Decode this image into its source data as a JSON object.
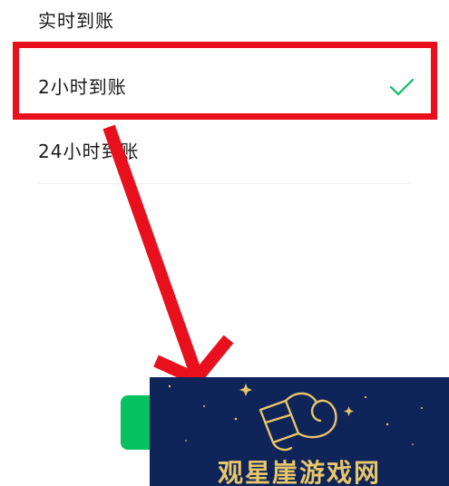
{
  "options": [
    {
      "label": "实时到账",
      "selected": false
    },
    {
      "label": "2小时到账",
      "selected": true
    },
    {
      "label": "24小时到账",
      "selected": false
    }
  ],
  "colors": {
    "annotation_red": "#e8101c",
    "check_green": "#07c160",
    "button_green": "#07c160",
    "watermark_bg": "#0f2458",
    "watermark_gold": "#e8c66a"
  },
  "icons": {
    "selected": "check-icon"
  },
  "watermark": {
    "text": "观星崖游戏网"
  }
}
